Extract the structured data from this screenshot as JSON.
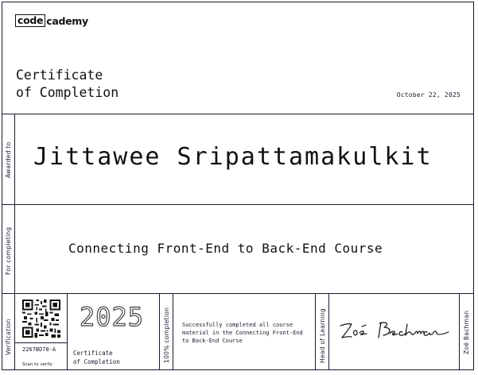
{
  "brand": {
    "logo_box": "code",
    "logo_rest": "cademy"
  },
  "certificate": {
    "title_line1": "Certificate",
    "title_line2": "of Completion",
    "date": "October 22, 2025"
  },
  "labels": {
    "awarded_to": "Awarded to",
    "for_completing": "For completing",
    "verification": "Verification",
    "completion": "100% completion",
    "head_of_learning": "Head of Learning",
    "signer_name": "Zoë Bachman"
  },
  "recipient": {
    "name": "Jittawee Sripattamakulkit"
  },
  "course": {
    "title": "Connecting Front-End to Back-End Course"
  },
  "verification": {
    "code": "2267BD78-A",
    "scan_label": "Scan to verify"
  },
  "footer": {
    "year": "2025",
    "year_label_line1": "Certificate",
    "year_label_line2": "of Completion",
    "description": "Successfully completed all course material in the Connecting Front-End to Back-End Course"
  },
  "signature": {
    "text": "Zoë Bachman"
  }
}
